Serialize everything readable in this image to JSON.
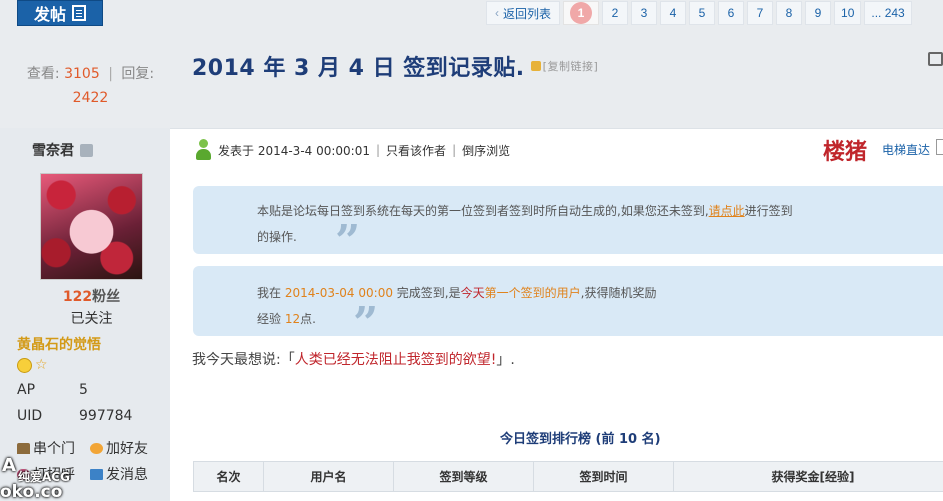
{
  "toolbar": {
    "post_label": "发帖"
  },
  "pager": {
    "back_label": "返回列表",
    "current": "1",
    "pages": [
      "2",
      "3",
      "4",
      "5",
      "6",
      "7",
      "8",
      "9",
      "10"
    ],
    "last": "... 243"
  },
  "stats": {
    "views_label": "查看:",
    "views": "3105",
    "separator": "|",
    "replies_label": "回复:",
    "replies": "2422"
  },
  "thread": {
    "title": "2014 年 3 月 4 日 签到记录贴.",
    "copy_link": "[复制链接]"
  },
  "user": {
    "name": "雪奈君",
    "fans_count": "122",
    "fans_label": "粉丝",
    "followed": "已关注",
    "rank": "黄晶石的觉悟",
    "ap_label": "AP",
    "ap_value": "5",
    "uid_label": "UID",
    "uid_value": "997784",
    "links": [
      "串个门",
      "加好友",
      "打招呼",
      "发消息"
    ]
  },
  "watermark": {
    "text": "纯爱ACG",
    "domain": "oko.co",
    "mark": "A"
  },
  "post": {
    "meta_posted": "发表于 2014-3-4 00:00:01",
    "only_author": "只看该作者",
    "reverse": "倒序浏览",
    "floor": "楼猪",
    "jump": "电梯直达"
  },
  "notice1": {
    "line1_pre": "本贴是论坛每日签到系统在每天的第一位签到者签到时所自动生成的,如果您还未签到,",
    "link": "请点此",
    "line1_post": "进行签到",
    "line2": "的操作."
  },
  "notice2": {
    "pre": "我在 ",
    "date": "2014-03-04 00:00",
    "mid": " 完成签到,是",
    "today": "今天",
    "first": "第一个签到的用户",
    "post": ",获得随机奖励",
    "exp_label": "经验 ",
    "exp_value": "12",
    "exp_unit": "点."
  },
  "mood": {
    "prefix": "我今天最想说:「",
    "text": "人类已经无法阻止我签到的欲望!",
    "suffix": "」."
  },
  "ranking": {
    "title": "今日签到排行榜 (前 10 名)",
    "headers": [
      "名次",
      "用户名",
      "签到等级",
      "签到时间",
      "获得奖金[经验]"
    ]
  }
}
